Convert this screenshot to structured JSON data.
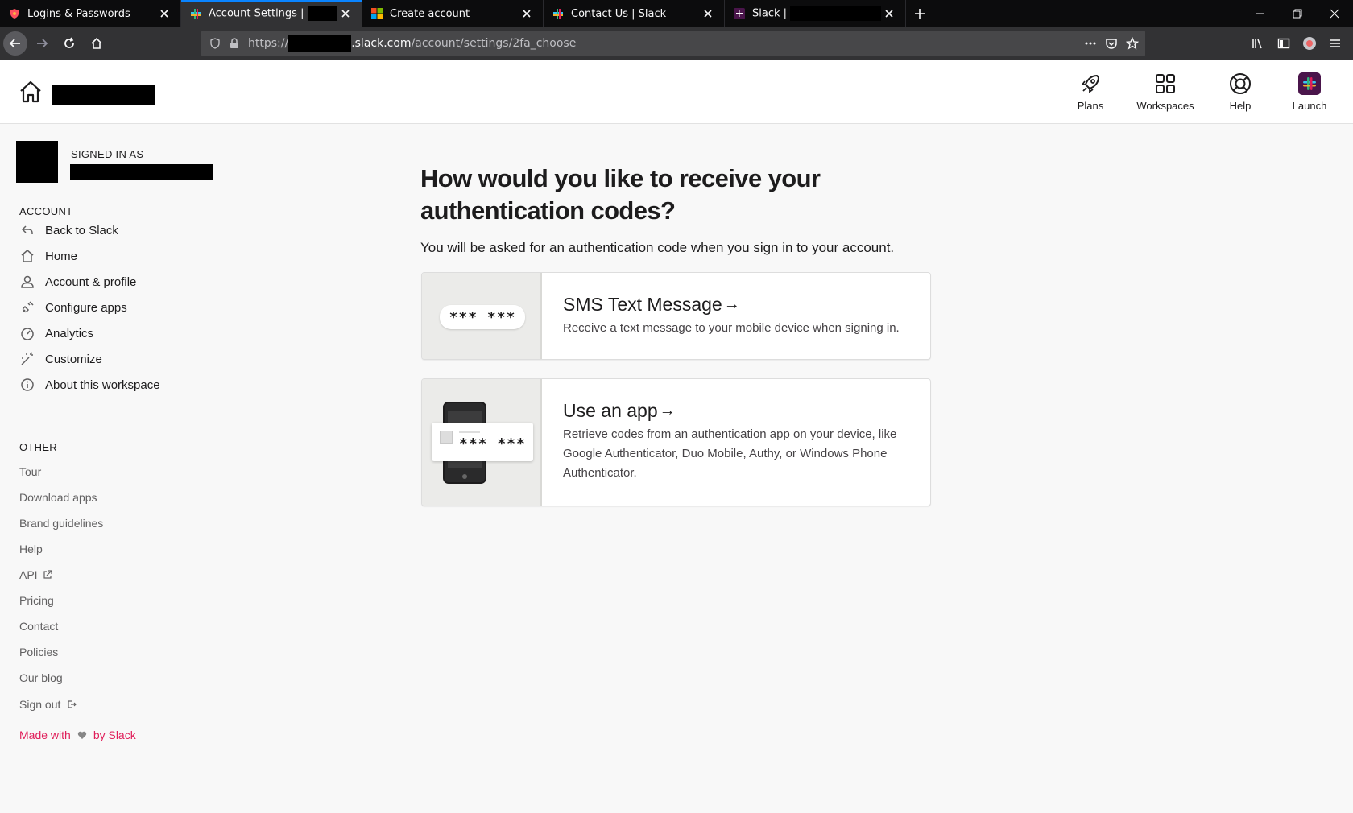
{
  "browser": {
    "tabs": [
      {
        "title": "Logins & Passwords"
      },
      {
        "title": "Account Settings |"
      },
      {
        "title": "Create account"
      },
      {
        "title": "Contact Us | Slack"
      },
      {
        "title": "Slack |"
      }
    ],
    "url": {
      "scheme": "https://",
      "host": ".slack.com",
      "path": "/account/settings/2fa_choose"
    }
  },
  "topnav": {
    "items": [
      {
        "label": "Plans",
        "icon": "rocket-icon"
      },
      {
        "label": "Workspaces",
        "icon": "grid-icon"
      },
      {
        "label": "Help",
        "icon": "lifebuoy-icon"
      },
      {
        "label": "Launch",
        "icon": "slack-logo-icon"
      }
    ]
  },
  "sidebar": {
    "signed_in_label": "SIGNED IN AS",
    "account_heading": "ACCOUNT",
    "account_items": [
      {
        "label": "Back to Slack",
        "icon": "back-arrow-icon"
      },
      {
        "label": "Home",
        "icon": "home-icon"
      },
      {
        "label": "Account & profile",
        "icon": "person-icon"
      },
      {
        "label": "Configure apps",
        "icon": "plug-icon"
      },
      {
        "label": "Analytics",
        "icon": "gauge-icon"
      },
      {
        "label": "Customize",
        "icon": "magic-wand-icon"
      },
      {
        "label": "About this workspace",
        "icon": "info-icon"
      }
    ],
    "other_heading": "OTHER",
    "other_items": [
      {
        "label": "Tour"
      },
      {
        "label": "Download apps"
      },
      {
        "label": "Brand guidelines"
      },
      {
        "label": "Help"
      },
      {
        "label": "API"
      },
      {
        "label": "Pricing"
      },
      {
        "label": "Contact"
      },
      {
        "label": "Policies"
      },
      {
        "label": "Our blog"
      },
      {
        "label": "Sign out"
      }
    ],
    "made_with": {
      "prefix": "Made with",
      "suffix": "by Slack"
    }
  },
  "main": {
    "title": "How would you like to receive your authentication codes?",
    "subtitle": "You will be asked for an authentication code when you sign in to your account.",
    "options": [
      {
        "title": "SMS Text Message",
        "arrow": "→",
        "description": "Receive a text message to your mobile device when signing in.",
        "code_mask": "*** ***"
      },
      {
        "title": "Use an app",
        "arrow": "→",
        "description": "Retrieve codes from an authentication app on your device, like Google Authenticator, Duo Mobile, Authy, or Windows Phone Authenticator.",
        "code_mask": "*** ***"
      }
    ]
  },
  "colors": {
    "accent_tab": "#0a84ff",
    "made_with": "#e01e5a"
  }
}
